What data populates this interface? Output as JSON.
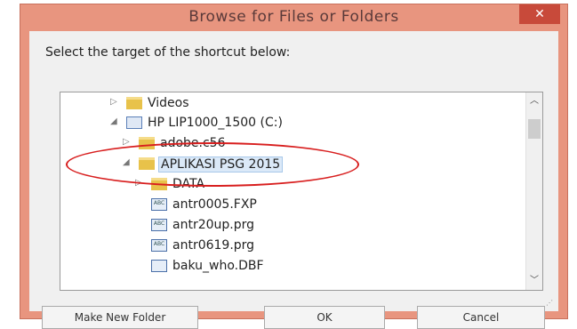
{
  "dialog": {
    "title": "Browse for Files or Folders",
    "close_glyph": "✕",
    "instruction": "Select the target of the shortcut below:"
  },
  "tree": {
    "items": [
      {
        "label": "Videos",
        "icon": "video-folder-icon",
        "arrow": "▷"
      },
      {
        "label": "HP LIP1000_1500 (C:)",
        "icon": "drive-icon",
        "arrow": "◢"
      },
      {
        "label": "adobe.c56",
        "icon": "folder-icon",
        "arrow": "▷"
      },
      {
        "label": "APLIKASI PSG 2015",
        "icon": "folder-icon",
        "arrow": "◢"
      },
      {
        "label": "DATA",
        "icon": "folder-icon",
        "arrow": "▷"
      },
      {
        "label": "antr0005.FXP",
        "icon": "file-icon",
        "icon_text": "ABC"
      },
      {
        "label": "antr20up.prg",
        "icon": "file-icon",
        "icon_text": "ABC"
      },
      {
        "label": "antr0619.prg",
        "icon": "file-icon",
        "icon_text": "ABC"
      },
      {
        "label": "baku_who.DBF",
        "icon": "file-icon",
        "icon_text": ""
      }
    ],
    "scroll_up": "︿",
    "scroll_down": "﹀"
  },
  "buttons": {
    "new_folder": "Make New Folder",
    "ok": "OK",
    "cancel": "Cancel"
  },
  "colors": {
    "title_bar": "#e8957f",
    "close_button": "#c84a3a",
    "highlight_ellipse": "#d81f1f"
  }
}
